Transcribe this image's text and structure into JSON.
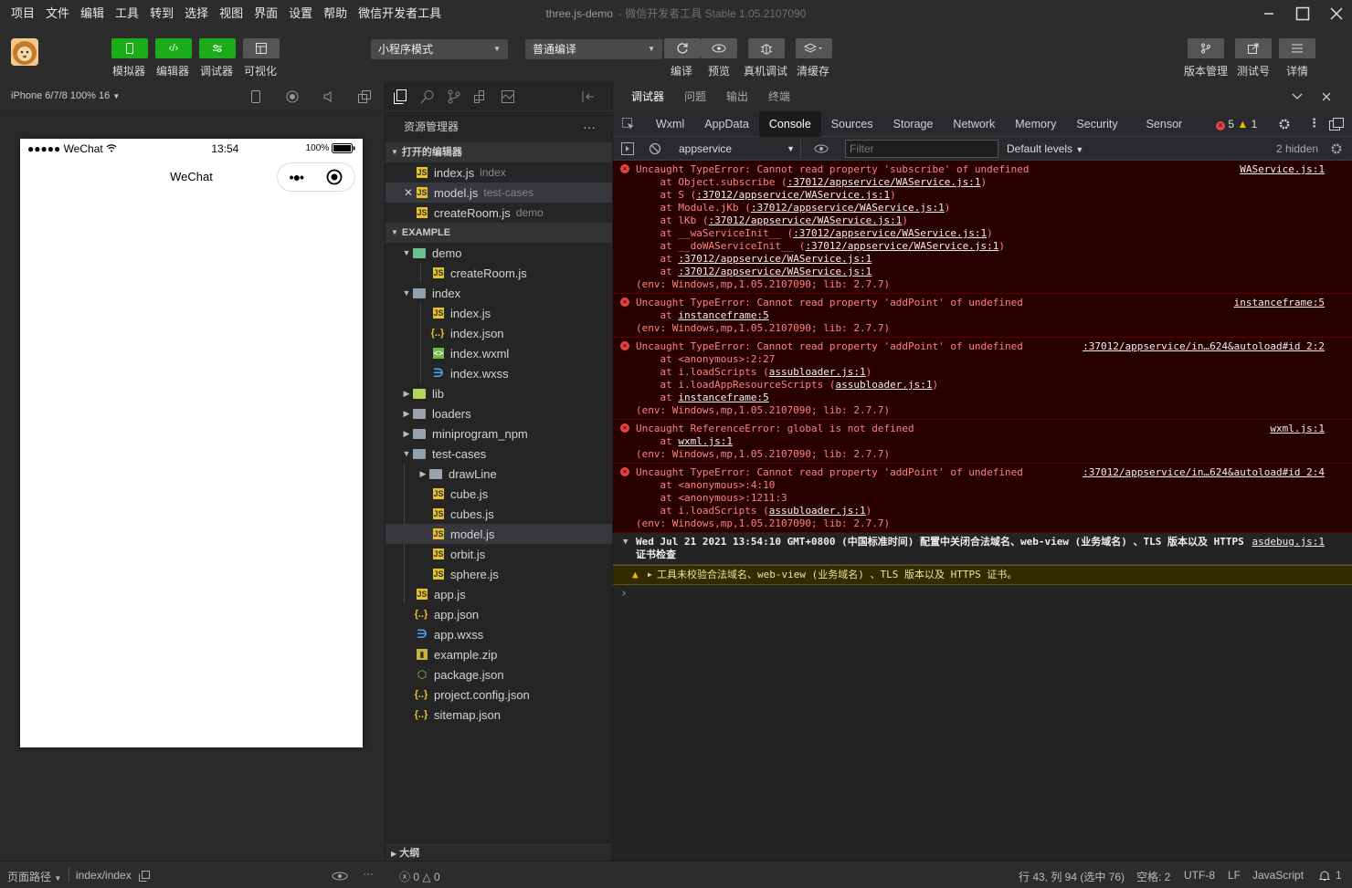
{
  "menu": [
    "项目",
    "文件",
    "编辑",
    "工具",
    "转到",
    "选择",
    "视图",
    "界面",
    "设置",
    "帮助",
    "微信开发者工具"
  ],
  "window": {
    "title": "three.js-demo",
    "version": "- 微信开发者工具 Stable 1.05.2107090"
  },
  "toolbar": {
    "simulator": "模拟器",
    "editor": "编辑器",
    "debugger": "调试器",
    "visual": "可视化",
    "mode_select": "小程序模式",
    "compile_select": "普通编译",
    "compile": "编译",
    "preview": "预览",
    "real_debug": "真机调试",
    "clear_cache": "清缓存",
    "version_mgmt": "版本管理",
    "test_number": "测试号",
    "details": "详情"
  },
  "simulator": {
    "device": "iPhone 6/7/8 100% 16",
    "carrier": "●●●●● WeChat",
    "time": "13:54",
    "battery": "100%",
    "nav_title": "WeChat"
  },
  "explorer": {
    "title": "资源管理器",
    "open_editors_label": "打开的编辑器",
    "open_editors": [
      {
        "name": "index.js",
        "dir": "index"
      },
      {
        "name": "model.js",
        "dir": "test-cases"
      },
      {
        "name": "createRoom.js",
        "dir": "demo"
      }
    ],
    "project_label": "EXAMPLE",
    "tree": {
      "demo": "demo",
      "createRoom": "createRoom.js",
      "index": "index",
      "index_js": "index.js",
      "index_json": "index.json",
      "index_wxml": "index.wxml",
      "index_wxss": "index.wxss",
      "lib": "lib",
      "loaders": "loaders",
      "miniprogram_npm": "miniprogram_npm",
      "test_cases": "test-cases",
      "drawLine": "drawLine",
      "cube": "cube.js",
      "cubes": "cubes.js",
      "model": "model.js",
      "orbit": "orbit.js",
      "sphere": "sphere.js",
      "app_js": "app.js",
      "app_json": "app.json",
      "app_wxss": "app.wxss",
      "example_zip": "example.zip",
      "package_json": "package.json",
      "project_config": "project.config.json",
      "sitemap": "sitemap.json"
    },
    "outline_label": "大纲"
  },
  "devtools": {
    "top_tabs": [
      "调试器",
      "问题",
      "输出",
      "终端"
    ],
    "panel_tabs": [
      "Wxml",
      "AppData",
      "Console",
      "Sources",
      "Storage",
      "Network",
      "Memory",
      "Security",
      "Sensor"
    ],
    "error_count": "5",
    "warning_count": "1",
    "context": "appservice",
    "filter_placeholder": "Filter",
    "levels": "Default levels",
    "hidden": "2 hidden"
  },
  "console": {
    "e1": {
      "head": "Uncaught TypeError: Cannot read property 'subscribe' of undefined",
      "src": "WAService.js:1",
      "l1a": "    at Object.subscribe (",
      "l1b": ":37012/appservice/WAService.js:1",
      "l1c": ")",
      "l2a": "    at S (",
      "l2b": ":37012/appservice/WAService.js:1",
      "l2c": ")",
      "l3a": "    at Module.jKb (",
      "l3b": ":37012/appservice/WAService.js:1",
      "l3c": ")",
      "l4a": "    at lKb (",
      "l4b": ":37012/appservice/WAService.js:1",
      "l4c": ")",
      "l5a": "    at __waServiceInit__ (",
      "l5b": ":37012/appservice/WAService.js:1",
      "l5c": ")",
      "l6a": "    at __doWAServiceInit__ (",
      "l6b": ":37012/appservice/WAService.js:1",
      "l6c": ")",
      "l7a": "    at ",
      "l7b": ":37012/appservice/WAService.js:1",
      "l8a": "    at ",
      "l8b": ":37012/appservice/WAService.js:1",
      "env": "(env: Windows,mp,1.05.2107090; lib: 2.7.7)"
    },
    "e2": {
      "head": "Uncaught TypeError: Cannot read property 'addPoint' of undefined",
      "src": "instanceframe:5",
      "l1a": "    at ",
      "l1b": "instanceframe:5",
      "env": "(env: Windows,mp,1.05.2107090; lib: 2.7.7)"
    },
    "e3": {
      "head": "Uncaught TypeError: Cannot read property 'addPoint' of undefined",
      "src": ":37012/appservice/in…624&autoload#id 2:2",
      "l1": "    at <anonymous>:2:27",
      "l2a": "    at i.loadScripts (",
      "l2b": "assubloader.js:1",
      "l2c": ")",
      "l3a": "    at i.loadAppResourceScripts (",
      "l3b": "assubloader.js:1",
      "l3c": ")",
      "l4a": "    at ",
      "l4b": "instanceframe:5",
      "env": "(env: Windows,mp,1.05.2107090; lib: 2.7.7)"
    },
    "e4": {
      "head": "Uncaught ReferenceError: global is not defined",
      "src": "wxml.js:1",
      "l1a": "    at ",
      "l1b": "wxml.js:1",
      "env": "(env: Windows,mp,1.05.2107090; lib: 2.7.7)"
    },
    "e5": {
      "head": "Uncaught TypeError: Cannot read property 'addPoint' of undefined",
      "src": ":37012/appservice/in…624&autoload#id 2:4",
      "l1": "    at <anonymous>:4:10",
      "l2": "    at <anonymous>:1211:3",
      "l3a": "    at i.loadScripts (",
      "l3b": "assubloader.js:1",
      "l3c": ")",
      "env": "(env: Windows,mp,1.05.2107090; lib: 2.7.7)"
    },
    "info": {
      "text": "Wed Jul 21 2021 13:54:10 GMT+0800 (中国标准时间) 配置中关闭合法域名、web-view (业务域名) 、TLS 版本以及 HTTPS 证书检查",
      "src": "asdebug.js:1"
    },
    "warn": "工具未校验合法域名、web-view (业务域名) 、TLS 版本以及 HTTPS 证书。",
    "prompt": "›"
  },
  "statusbar": {
    "page_path_label": "页面路径",
    "page_path": "index/index",
    "errors": "0",
    "warnings": "0",
    "cursor": "行 43, 列 94 (选中 76)",
    "spaces": "空格: 2",
    "encoding": "UTF-8",
    "eol": "LF",
    "language": "JavaScript",
    "notifications": "1"
  },
  "colors": {
    "accent_green": "#1aad19",
    "error_bg": "#290000",
    "error_text": "#ff8080"
  }
}
